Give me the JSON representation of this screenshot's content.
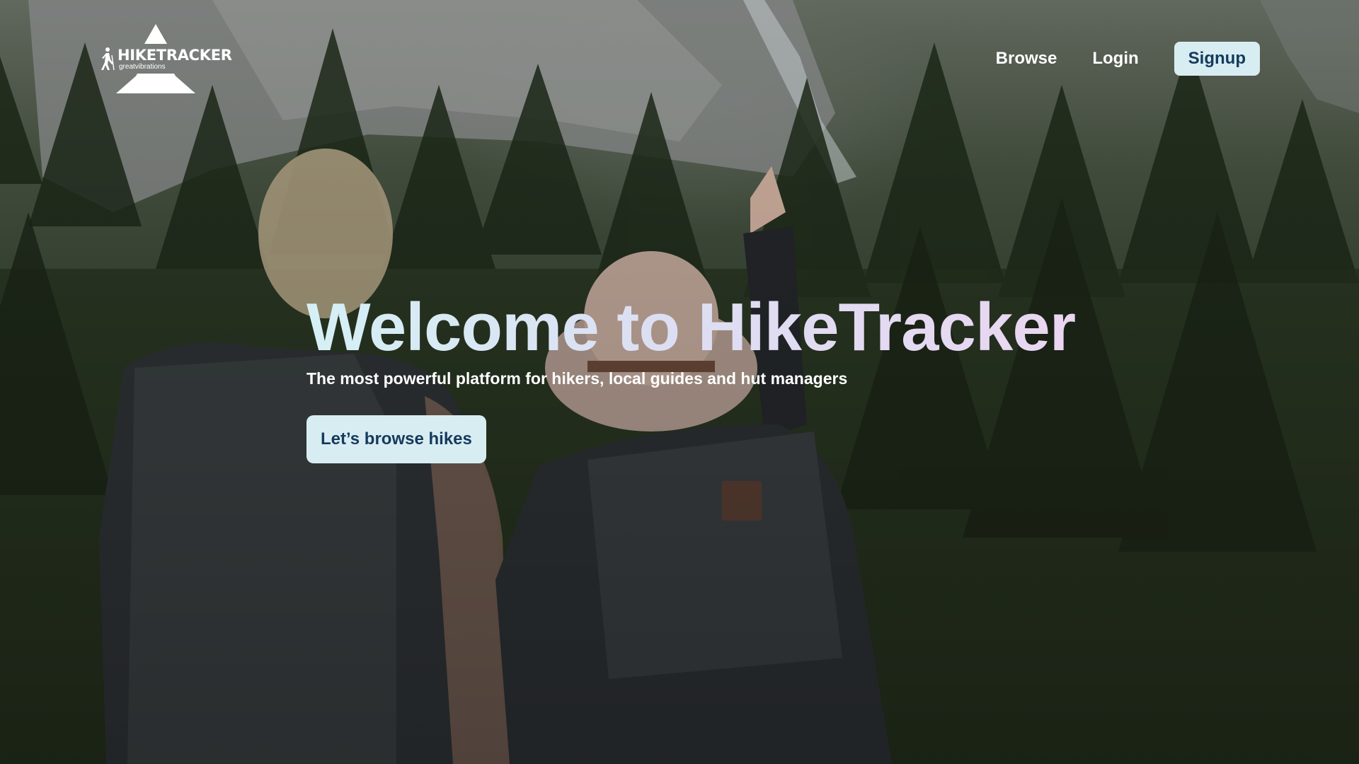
{
  "brand": {
    "name": "HIKETRACKER",
    "tagline": "greatvibrations"
  },
  "nav": {
    "browse_label": "Browse",
    "login_label": "Login",
    "signup_label": "Signup"
  },
  "hero": {
    "title": "Welcome to HikeTracker",
    "subtitle": "The most powerful platform for hikers, local guides and hut managers",
    "cta_label": "Let’s browse hikes"
  },
  "colors": {
    "button_bg": "#d8edf2",
    "button_text": "#153a5c",
    "title_gradient_start": "#d5f0f5",
    "title_gradient_end": "#ead6f1"
  },
  "icons": [
    "hiker-icon",
    "mountain-logo-icon"
  ]
}
